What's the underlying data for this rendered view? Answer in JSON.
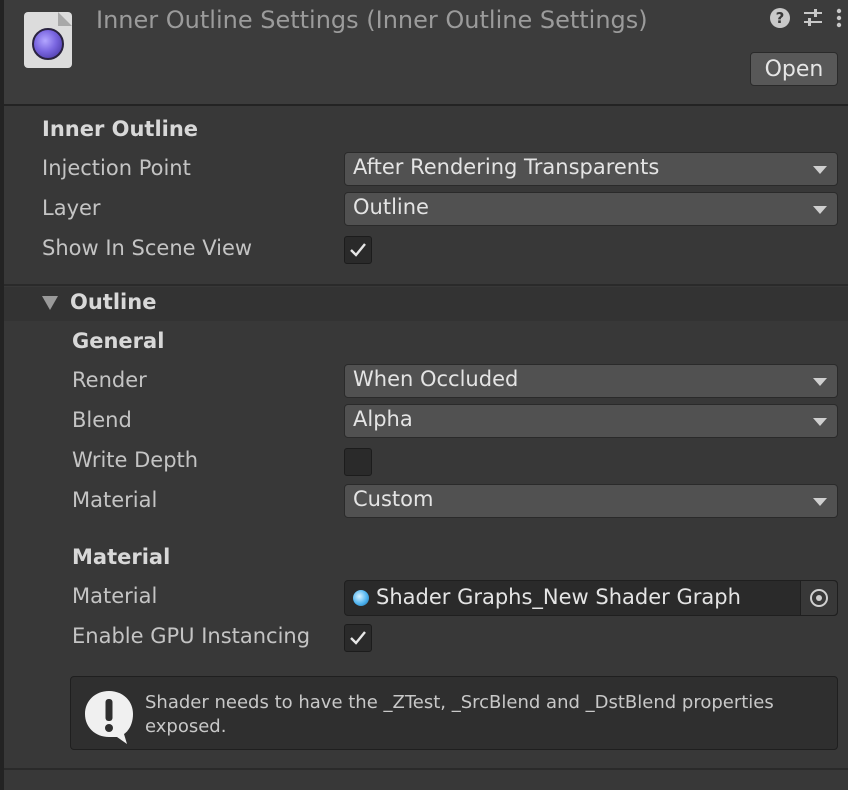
{
  "header": {
    "title": "Inner Outline Settings (Inner Outline Settings)",
    "open_label": "Open",
    "icons": [
      "help-icon",
      "preset-sliders-icon",
      "more-vertical-icon"
    ]
  },
  "inner_outline": {
    "section_title": "Inner Outline",
    "injection_point": {
      "label": "Injection Point",
      "value": "After Rendering Transparents"
    },
    "layer": {
      "label": "Layer",
      "value": "Outline"
    },
    "show_in_scene_view": {
      "label": "Show In Scene View",
      "checked": true
    }
  },
  "outline": {
    "foldout_label": "Outline",
    "general_title": "General",
    "render": {
      "label": "Render",
      "value": "When Occluded"
    },
    "blend": {
      "label": "Blend",
      "value": "Alpha"
    },
    "write_depth": {
      "label": "Write Depth",
      "checked": false
    },
    "material_mode": {
      "label": "Material",
      "value": "Custom"
    },
    "material_title": "Material",
    "material_field": {
      "label": "Material",
      "value": "Shader Graphs_New Shader Graph"
    },
    "gpu_instancing": {
      "label": "Enable GPU Instancing",
      "checked": true
    },
    "help_message": "Shader needs to have the _ZTest, _SrcBlend and _DstBlend properties exposed."
  }
}
